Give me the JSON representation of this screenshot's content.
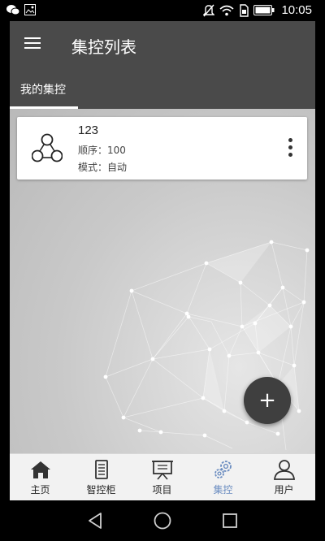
{
  "status_bar": {
    "time": "10:05",
    "left_icons": [
      "wechat-icon",
      "image-icon"
    ],
    "right_icons": [
      "mute-icon",
      "wifi-icon",
      "sim-icon",
      "battery-icon"
    ]
  },
  "app_bar": {
    "menu_icon": "menu-icon",
    "title": "集控列表"
  },
  "tabs": [
    {
      "label": "我的集控",
      "active": true
    }
  ],
  "cards": [
    {
      "icon": "group-nodes-icon",
      "title": "123",
      "order_line": "顺序：100",
      "mode_line": "模式：自动",
      "menu_icon": "more-vert-icon"
    }
  ],
  "fab": {
    "label": "+",
    "icon": "add-icon"
  },
  "bottom_nav": [
    {
      "label": "主页",
      "icon": "home-icon",
      "active": false
    },
    {
      "label": "智控柜",
      "icon": "cabinet-icon",
      "active": false
    },
    {
      "label": "项目",
      "icon": "project-board-icon",
      "active": false
    },
    {
      "label": "集控",
      "icon": "gears-icon",
      "active": true
    },
    {
      "label": "用户",
      "icon": "user-icon",
      "active": false
    }
  ],
  "system_nav": [
    "back-icon",
    "home-circle-icon",
    "recents-icon"
  ],
  "colors": {
    "app_bar": "#4a4a4a",
    "active_nav": "#6a8cc0",
    "fab": "#3f3f3f"
  }
}
